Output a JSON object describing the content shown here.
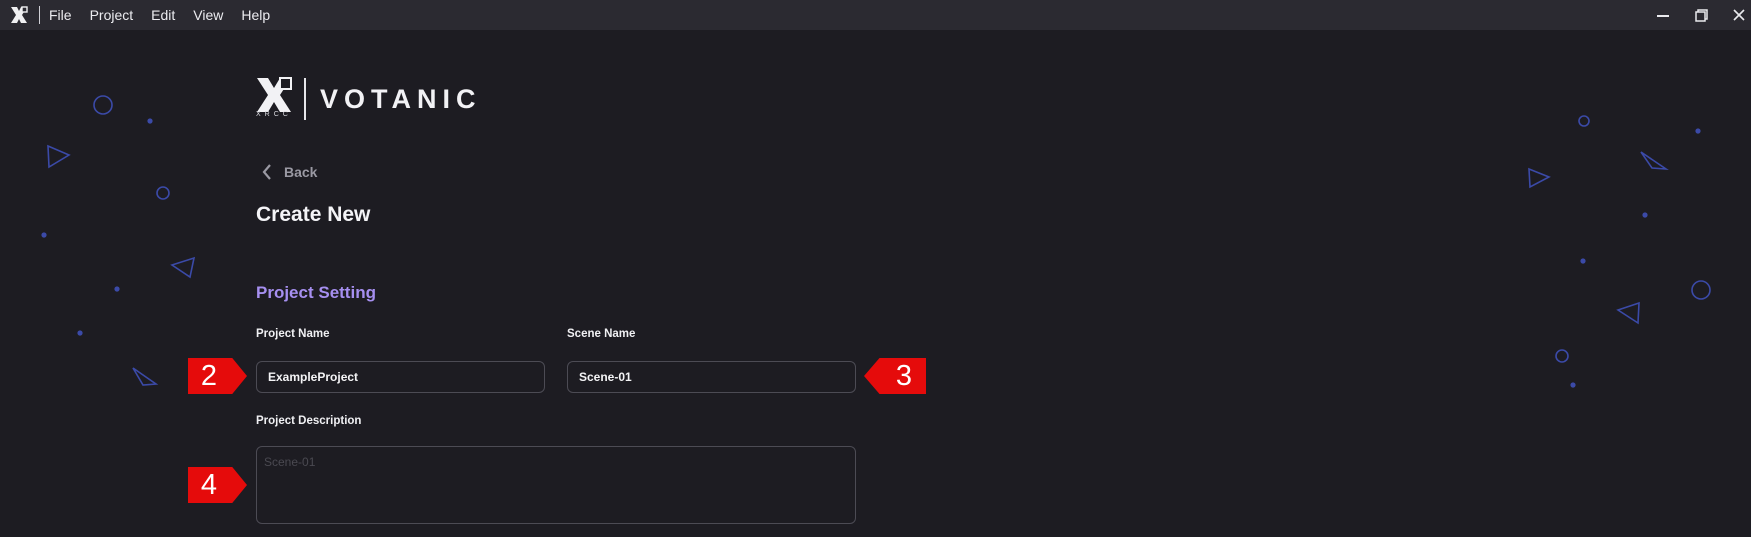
{
  "window": {
    "menu": [
      "File",
      "Project",
      "Edit",
      "View",
      "Help"
    ],
    "controls": {
      "minimize": "minimize-icon",
      "maximize": "restore-icon",
      "close": "close-icon"
    }
  },
  "brand": {
    "name": "VOTANIC",
    "sub": "XRCC",
    "logo": "xrcc-logo"
  },
  "nav": {
    "back_label": "Back"
  },
  "page": {
    "title": "Create New"
  },
  "section": {
    "title": "Project Setting"
  },
  "form": {
    "project_name": {
      "label": "Project Name",
      "value": "ExampleProject"
    },
    "scene_name": {
      "label": "Scene Name",
      "value": "Scene-01"
    },
    "project_description": {
      "label": "Project Description",
      "placeholder": "Scene-01",
      "value": ""
    }
  },
  "callouts": {
    "project_name": "2",
    "scene_name": "3",
    "project_description": "4"
  },
  "colors": {
    "background": "#1d1c22",
    "titlebar": "#2b2a31",
    "accent": "#a68ff0",
    "callout": "#e50b0b",
    "decoration": "#3b4aa8"
  }
}
